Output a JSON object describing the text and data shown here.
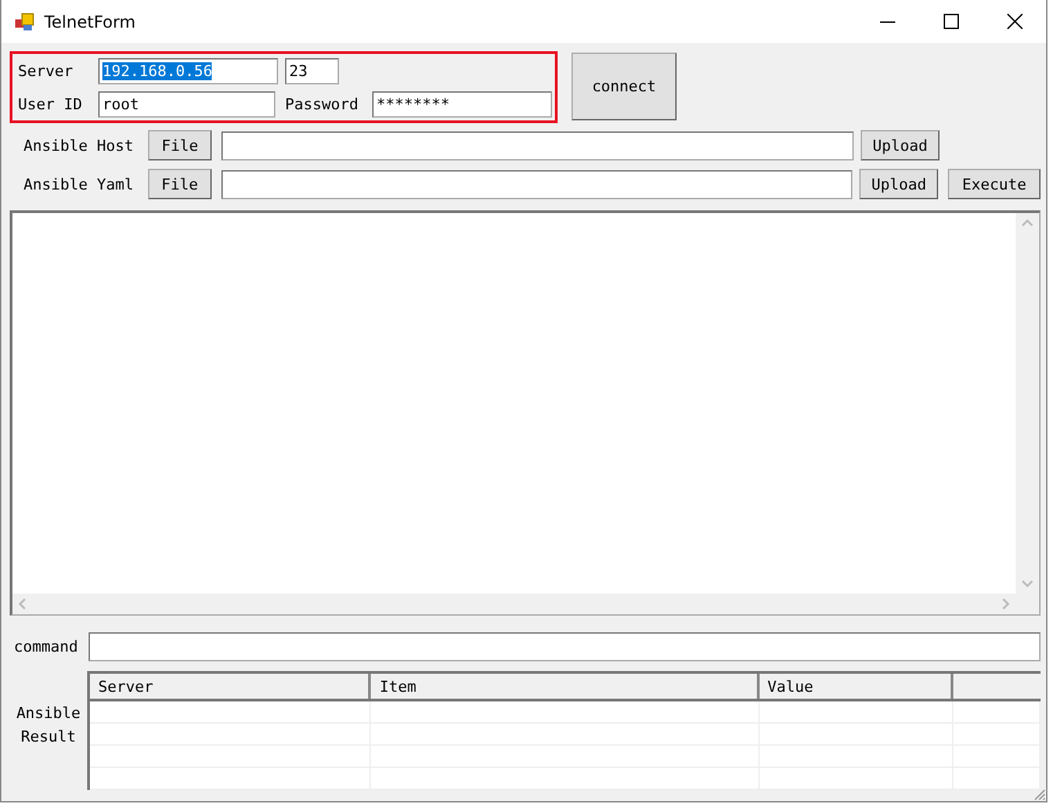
{
  "window": {
    "title": "TelnetForm"
  },
  "login": {
    "server_label": "Server",
    "server": {
      "value": "192.168.0.56",
      "text_selected": true
    },
    "port": {
      "value": "23",
      "text_selected": false
    },
    "user_label": "User ID",
    "user": {
      "value": "root",
      "text_selected": false
    },
    "password_label": "Password",
    "password": {
      "value": "********",
      "text_selected": false
    },
    "connect_button": "connect"
  },
  "file_rows": [
    {
      "label": "Ansible Host",
      "file_button": "File",
      "upload_button": "Upload"
    },
    {
      "label": "Ansible Yaml",
      "file_button": "File",
      "upload_button": "Upload",
      "extra_button": "Execute"
    }
  ],
  "command": {
    "label": "command"
  },
  "result": {
    "label": "Ansible Result",
    "columns": [
      "Server",
      "Item",
      "Value"
    ]
  }
}
